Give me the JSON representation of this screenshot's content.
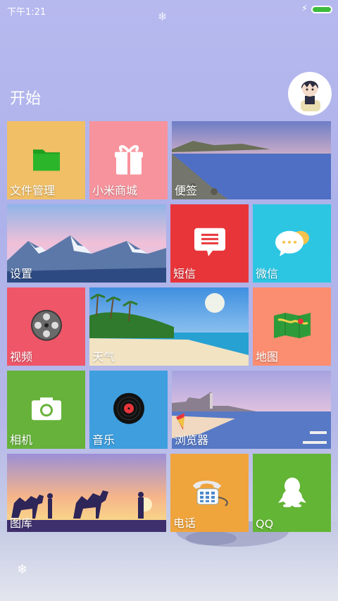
{
  "status_bar": {
    "time": "下午1:21"
  },
  "header": {
    "title": "开始"
  },
  "tiles": [
    {
      "label": "文件管理",
      "color": "#f0bf66"
    },
    {
      "label": "小米商城",
      "color": "#f7939c"
    },
    {
      "label": "便签"
    },
    {
      "label": "设置"
    },
    {
      "label": "短信",
      "color": "#e8353a"
    },
    {
      "label": "微信",
      "color": "#2cc6e3"
    },
    {
      "label": "视频",
      "color": "#ef5668"
    },
    {
      "label": "天气"
    },
    {
      "label": "地图",
      "color": "#fb8d70"
    },
    {
      "label": "相机",
      "color": "#66b23a"
    },
    {
      "label": "音乐",
      "color": "#3e9ede"
    },
    {
      "label": "浏览器"
    },
    {
      "label": "图库"
    },
    {
      "label": "电话",
      "color": "#f0a43c"
    },
    {
      "label": "QQ",
      "color": "#63b535"
    }
  ]
}
